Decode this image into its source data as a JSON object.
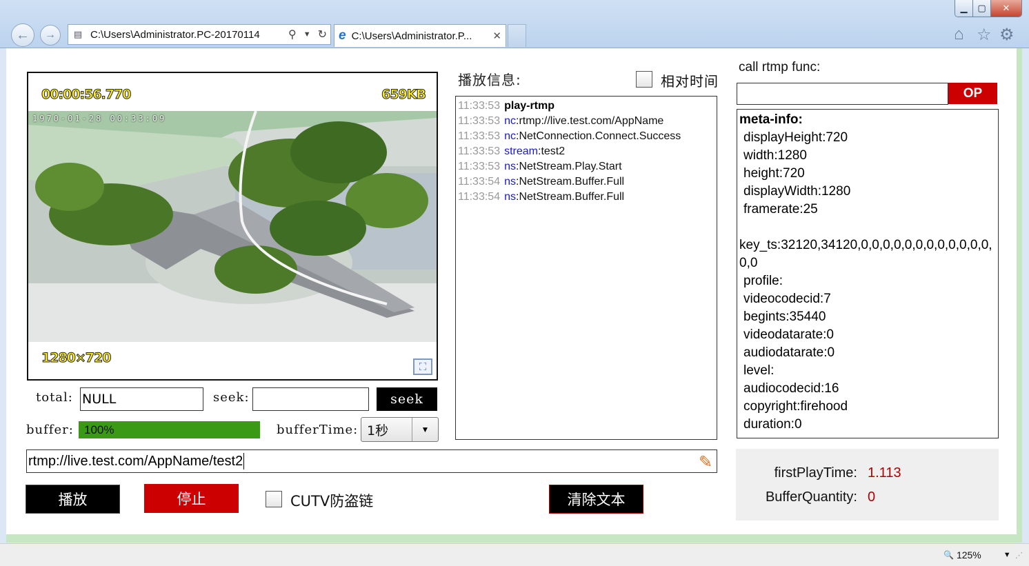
{
  "browser": {
    "address": "C:\\Users\\Administrator.PC-20170114",
    "tab_title": "C:\\Users\\Administrator.P...",
    "zoom": "125%"
  },
  "player": {
    "time": "00:00:56.770",
    "size": "659KB",
    "resolution": "1280×720",
    "osd": "1970-01-28   00:33:09"
  },
  "controls": {
    "total_label": "total:",
    "total_value": "NULL",
    "seek_label": "seek:",
    "seek_value": "",
    "seek_button": "seek",
    "buffer_label": "buffer:",
    "buffer_value": "100%",
    "buffer_percent": 100,
    "buffertime_label": "bufferTime:",
    "buffertime_value": "1秒",
    "url": "rtmp://live.test.com/AppName/test2",
    "play_button": "播放",
    "stop_button": "停止",
    "cutv_label": "CUTV防盗链",
    "clear_button": "清除文本"
  },
  "log": {
    "title": "播放信息:",
    "relative_time_label": "相对时间",
    "rows": [
      {
        "time": "11:33:53",
        "key": "",
        "value": "play-rtmp",
        "is_title": true
      },
      {
        "time": "11:33:53",
        "key": "nc",
        "value": ":rtmp://live.test.com/AppName",
        "is_title": false
      },
      {
        "time": "11:33:53",
        "key": "nc",
        "value": ":NetConnection.Connect.Success",
        "is_title": false
      },
      {
        "time": "11:33:53",
        "key": "stream",
        "value": ":test2",
        "is_title": false
      },
      {
        "time": "11:33:53",
        "key": "ns",
        "value": ":NetStream.Play.Start",
        "is_title": false
      },
      {
        "time": "11:33:54",
        "key": "ns",
        "value": ":NetStream.Buffer.Full",
        "is_title": false
      },
      {
        "time": "11:33:54",
        "key": "ns",
        "value": ":NetStream.Buffer.Full",
        "is_title": false
      }
    ]
  },
  "rtmp": {
    "label": "call rtmp func:",
    "input_value": "",
    "op_button": "OP"
  },
  "meta": {
    "heading": "meta-info:",
    "lines_a": [
      "displayHeight:720",
      "width:1280",
      "height:720",
      "displayWidth:1280",
      "framerate:25"
    ],
    "key_ts": "key_ts:32120,34120,0,0,0,0,0,0,0,0,0,0,0,0,0,0",
    "lines_b": [
      "profile:",
      "videocodecid:7",
      "begints:35440",
      "videodatarate:0",
      "audiodatarate:0",
      "level:",
      "audiocodecid:16",
      "copyright:firehood",
      "duration:0"
    ]
  },
  "stats": {
    "first_play_label": "firstPlayTime:",
    "first_play_value": "1.113",
    "buffer_qty_label": "BufferQuantity:",
    "buffer_qty_value": "0"
  }
}
